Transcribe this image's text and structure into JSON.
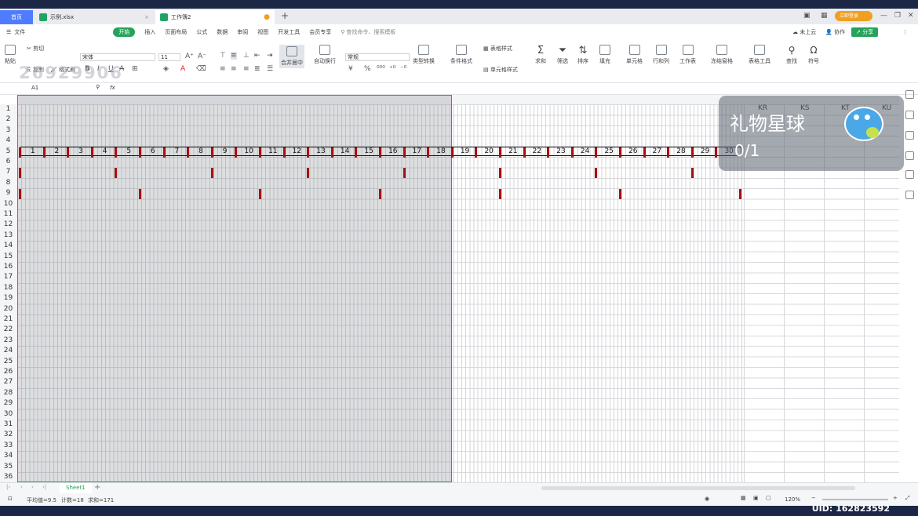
{
  "tabs": [
    {
      "label": "首页"
    },
    {
      "label": "示例.xlsx"
    },
    {
      "label": "工作簿2"
    }
  ],
  "title_right": {
    "login_label": "立即登录"
  },
  "menu": {
    "items": [
      "文件",
      "开始",
      "插入",
      "页面布局",
      "公式",
      "数据",
      "审阅",
      "视图",
      "开发工具",
      "会员专享"
    ],
    "active": "开始",
    "search_placeholder": "查找命令、搜索模板",
    "cloud_label": "未上云",
    "collab_label": "协作",
    "share_label": "分享"
  },
  "ribbon": {
    "paste": "粘贴",
    "cut": "剪切",
    "copy": "复制",
    "format_painter": "格式刷",
    "font_name": "宋体",
    "font_size": "11",
    "merge": "合并居中",
    "wrap": "自动换行",
    "number_format": "常规",
    "type_convert": "类型转换",
    "cond_format": "条件格式",
    "table_style": "表格样式",
    "cell_style": "单元格样式",
    "sum": "求和",
    "filter": "筛选",
    "sort": "排序",
    "fill": "填充",
    "cell": "单元格",
    "rowcol": "行和列",
    "worksheet": "工作表",
    "freeze": "冻结窗格",
    "table_tools": "表格工具",
    "find": "查找",
    "symbol": "符号"
  },
  "formula_bar": {
    "cell_ref": "A1",
    "fx": "fx"
  },
  "columns_right": [
    "KR",
    "KS",
    "KT",
    "KU"
  ],
  "day_numbers": [
    "1",
    "2",
    "3",
    "4",
    "5",
    "6",
    "7",
    "8",
    "9",
    "10",
    "11",
    "12",
    "13",
    "14",
    "15",
    "16",
    "17",
    "18",
    "19",
    "20",
    "21",
    "22",
    "23",
    "24",
    "25",
    "26",
    "27",
    "28",
    "29",
    "30"
  ],
  "row_numbers": [
    "1",
    "2",
    "3",
    "4",
    "5",
    "6",
    "7",
    "8",
    "9",
    "10",
    "11",
    "12",
    "13",
    "14",
    "15",
    "16",
    "17",
    "18",
    "19",
    "20",
    "21",
    "22",
    "23",
    "24",
    "25",
    "26",
    "27",
    "28",
    "29",
    "30",
    "31",
    "32",
    "33",
    "34",
    "35",
    "36"
  ],
  "marks": [
    {
      "row": 5,
      "days": [
        "1",
        "2",
        "3",
        "4",
        "5",
        "6",
        "7",
        "8",
        "9",
        "10",
        "11",
        "12",
        "13",
        "14",
        "15",
        "16",
        "17",
        "18",
        "19",
        "20",
        "21",
        "22",
        "23",
        "24",
        "25",
        "26",
        "27",
        "28",
        "29",
        "30"
      ]
    },
    {
      "row": 7,
      "days": [
        "1",
        "5",
        "9",
        "13",
        "17",
        "21",
        "25",
        "29"
      ]
    },
    {
      "row": 9,
      "days": [
        "1",
        "6",
        "11",
        "16",
        "21",
        "26",
        "31"
      ]
    }
  ],
  "sheet": {
    "tab": "Sheet1"
  },
  "status": {
    "average": "平均值=9.5",
    "count": "计数=18",
    "sum": "求和=171",
    "zoom": "120%"
  },
  "overlay": {
    "gift_title": "礼物星球",
    "gift_count": "0/1",
    "watermark": "26929906",
    "uid": "UID: 162823592"
  },
  "colors": {
    "accent": "#25a35a",
    "mark": "#a51111",
    "selection": "#25a35a"
  }
}
